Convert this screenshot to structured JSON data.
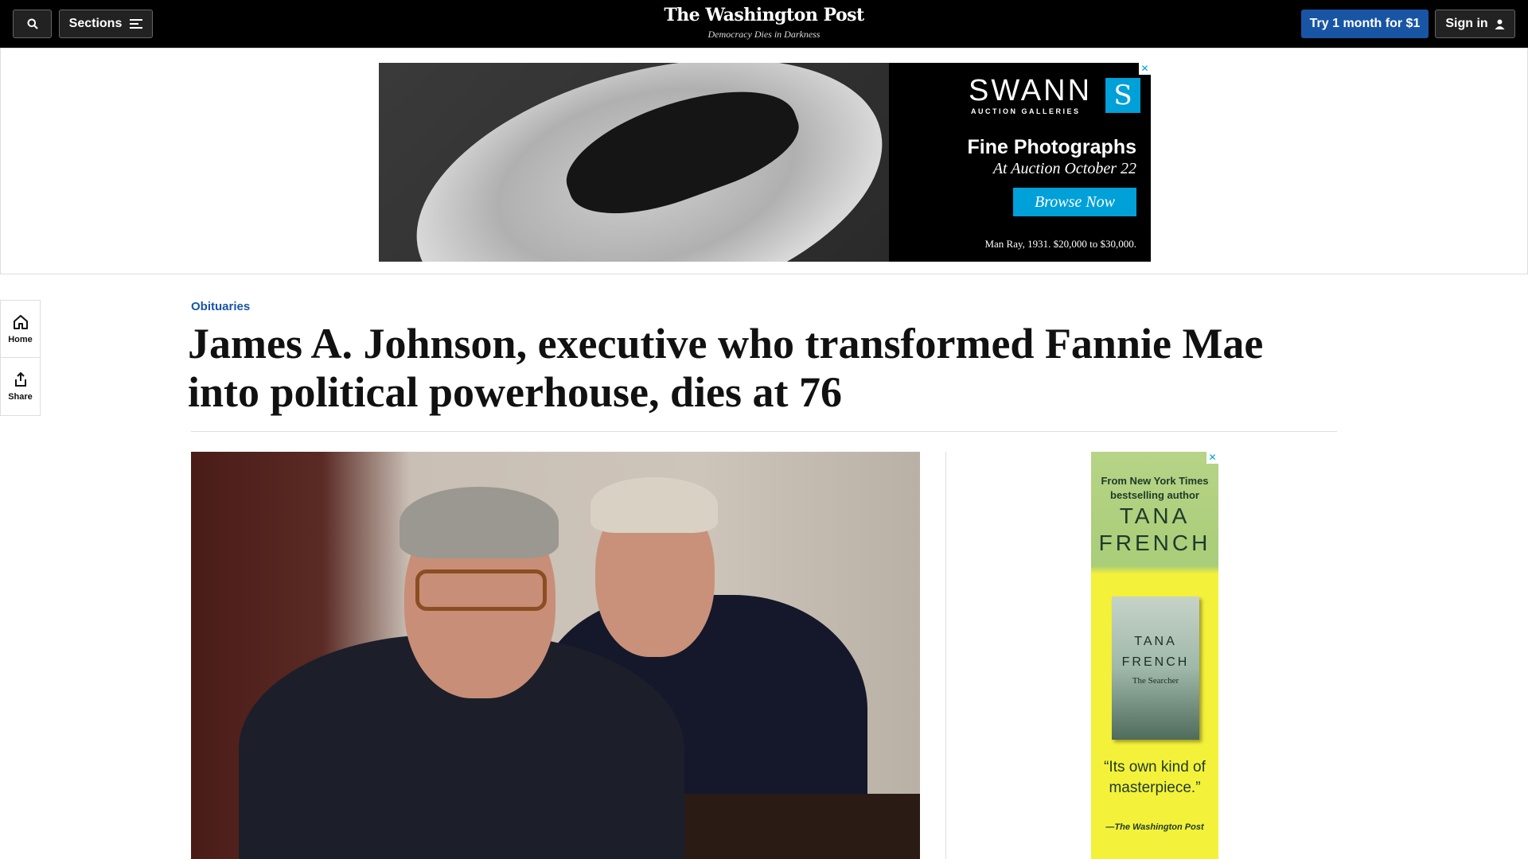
{
  "header": {
    "sections_label": "Sections",
    "logo": "The Washington Post",
    "tagline": "Democracy Dies in Darkness",
    "subscribe_label": "Try 1 month for $1",
    "signin_label": "Sign in"
  },
  "top_ad": {
    "brand": "SWANN",
    "brand_sub": "AUCTION GALLERIES",
    "headline": "Fine Photographs",
    "subheadline": "At Auction October 22",
    "cta": "Browse Now",
    "credit": "Man Ray, 1931. $20,000 to $30,000."
  },
  "left_rail": {
    "home_label": "Home",
    "share_label": "Share"
  },
  "article": {
    "kicker": "Obituaries",
    "headline": "James A. Johnson, executive who transformed Fannie Mae into political powerhouse, dies at 76"
  },
  "side_ad": {
    "from_line1": "From New York Times",
    "from_line2": "bestselling author",
    "author_line1": "TANA",
    "author_line2": "FRENCH",
    "book_author_line1": "TANA",
    "book_author_line2": "FRENCH",
    "book_title": "The Searcher",
    "quote": "“Its own kind of masterpiece.”",
    "quote_source": "—The Washington Post"
  },
  "colors": {
    "accent_blue": "#1955a5",
    "ad_blue": "#00a0d8",
    "topbar": "#000000"
  }
}
